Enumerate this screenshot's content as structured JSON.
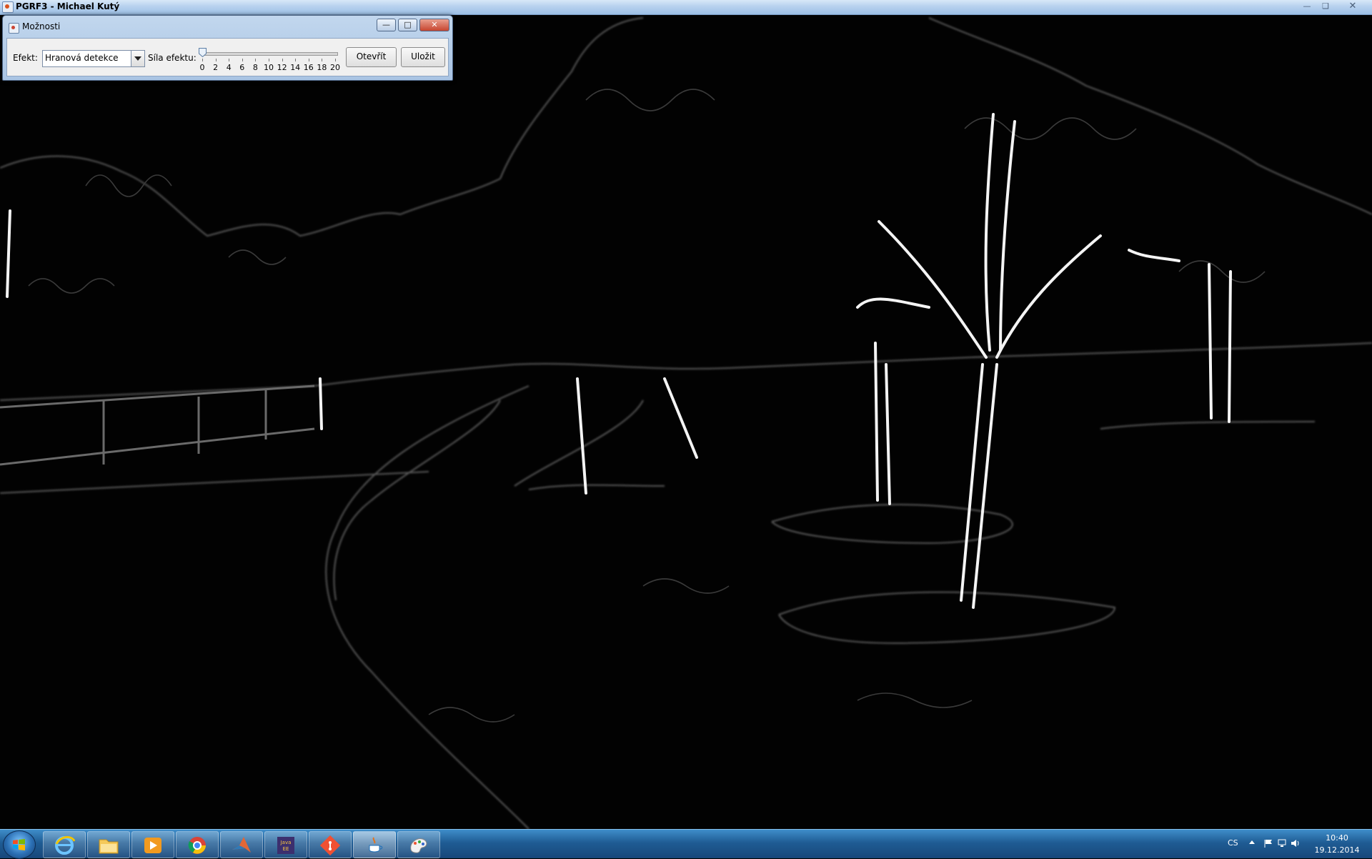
{
  "window": {
    "title": "PGRF3 - Michael Kutý",
    "controls": [
      "minimize",
      "maximize",
      "close"
    ]
  },
  "dialog": {
    "title": "Možnosti",
    "effect_label": "Efekt:",
    "effect_value": "Hranová detekce",
    "strength_label": "Síla efektu:",
    "strength_value": 0,
    "ticks": [
      "0",
      "2",
      "4",
      "6",
      "8",
      "10",
      "12",
      "14",
      "16",
      "18",
      "20"
    ],
    "open_button": "Otevřít",
    "save_button": "Uložit"
  },
  "taskbar": {
    "items": [
      "start-button",
      "internet-explorer-icon",
      "file-explorer-icon",
      "media-player-icon",
      "chrome-icon",
      "matlab-icon",
      "eclipse-java-ee-icon",
      "git-icon",
      "java-app-icon",
      "paint-icon"
    ],
    "language": "CS",
    "time": "10:40",
    "date": "19.12.2014"
  }
}
